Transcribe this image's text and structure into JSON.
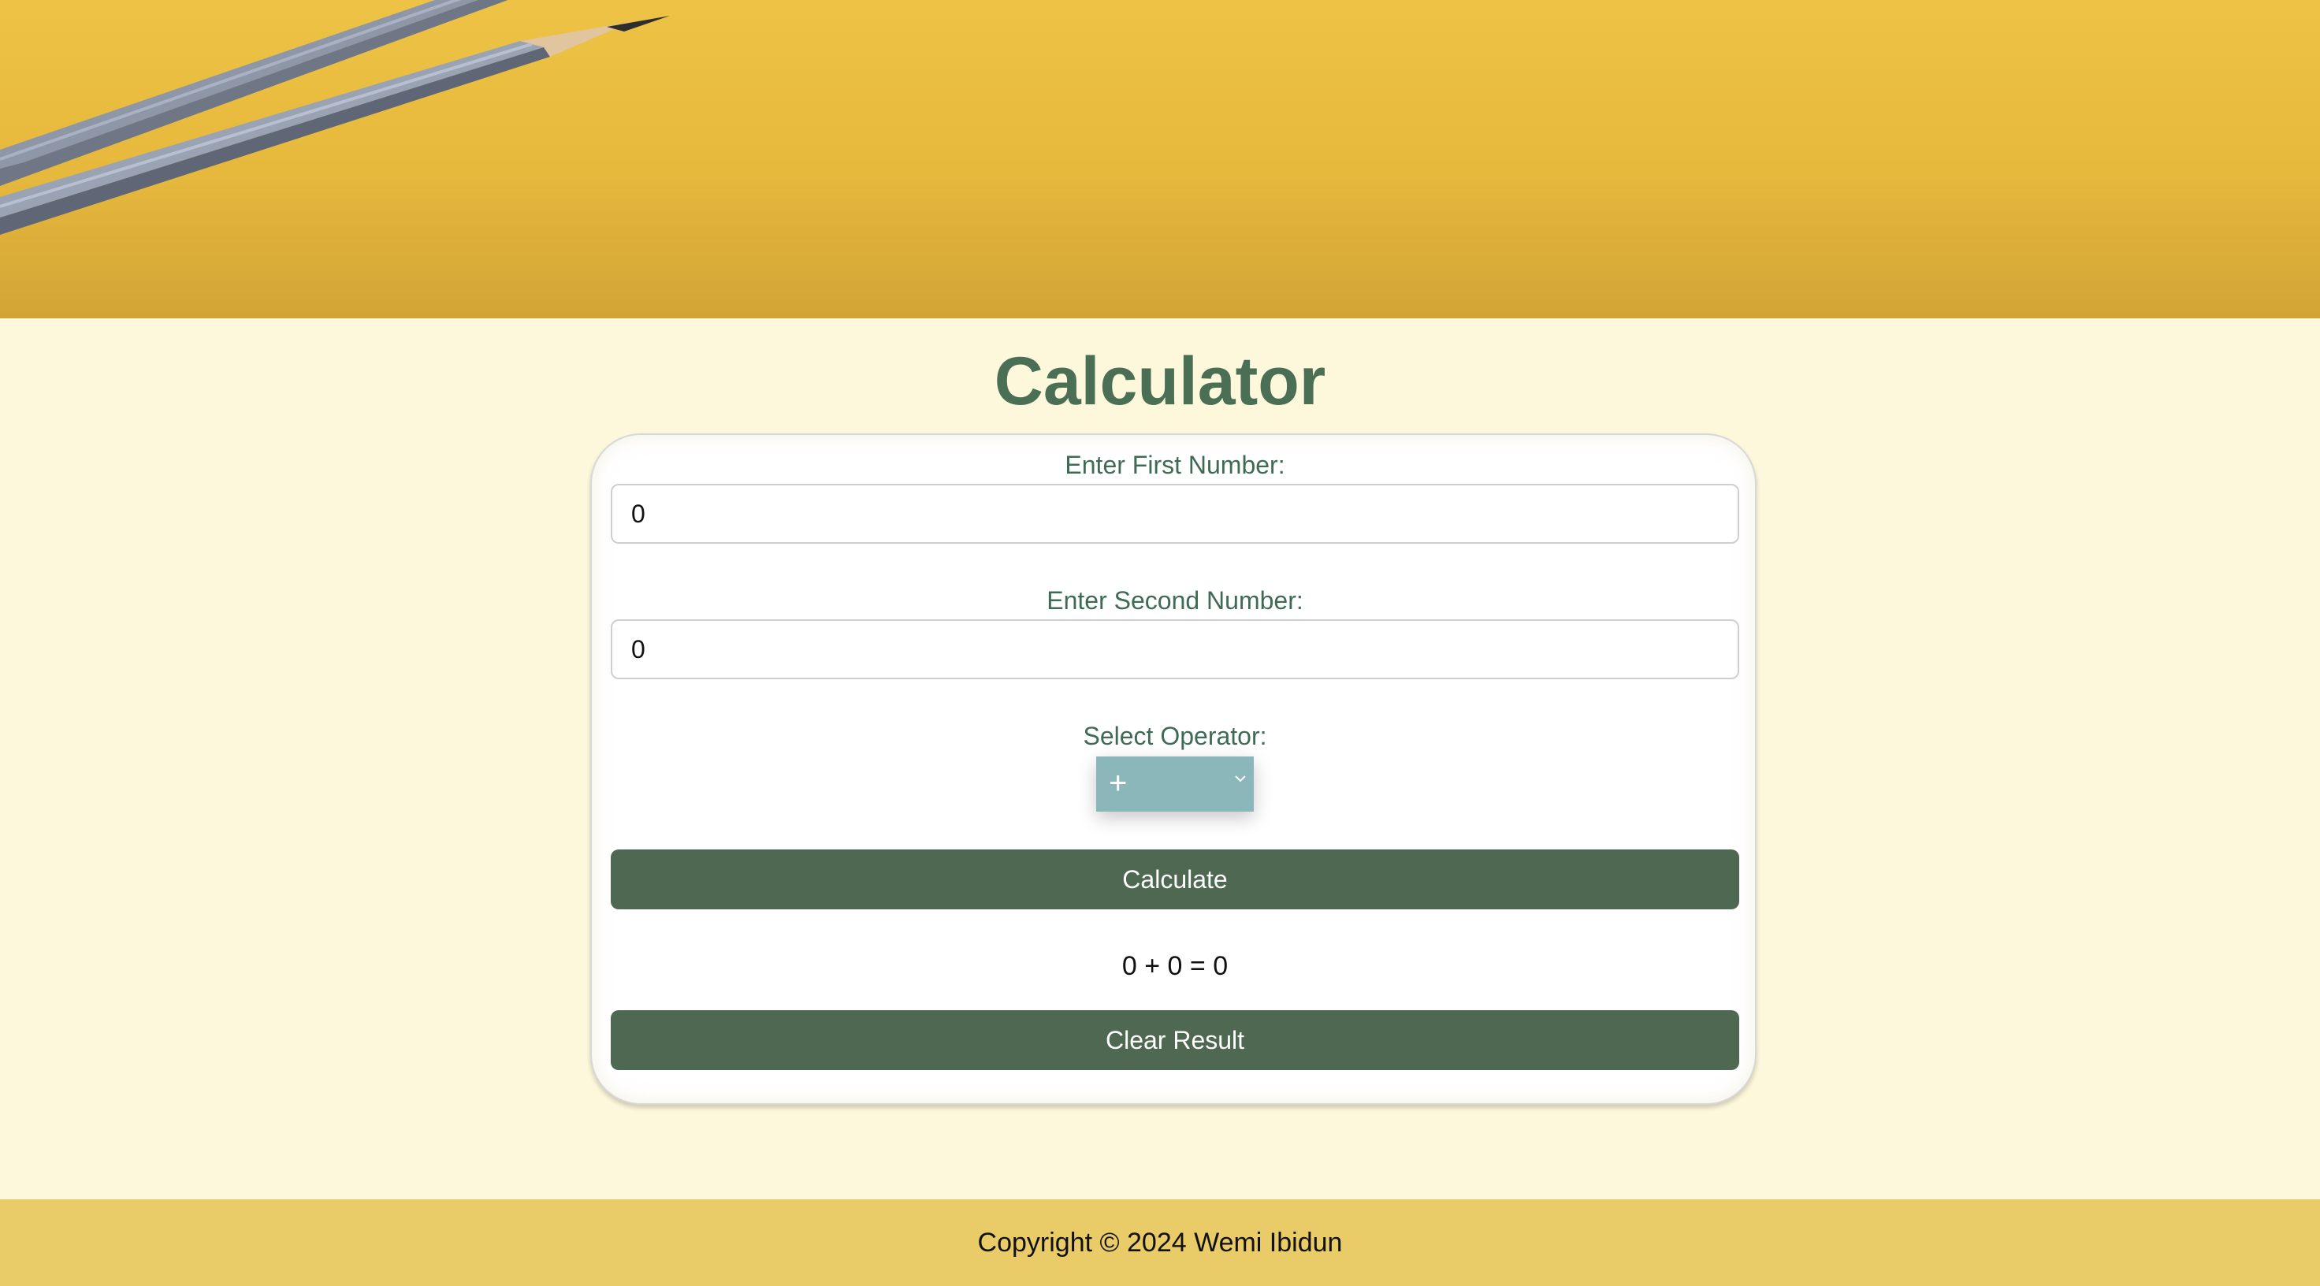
{
  "header": {
    "image": "pencils-on-yellow-banner"
  },
  "page": {
    "title": "Calculator"
  },
  "form": {
    "first_label": "Enter First Number:",
    "first_value": "0",
    "second_label": "Enter Second Number:",
    "second_value": "0",
    "operator_label": "Select Operator:",
    "operator_value": "+",
    "calculate_label": "Calculate",
    "result_text": "0 + 0 = 0",
    "clear_label": "Clear Result"
  },
  "footer": {
    "copyright": "Copyright © 2024 Wemi Ibidun"
  },
  "colors": {
    "banner": "#eec345",
    "background": "#fdf8dc",
    "title": "#4a6f55",
    "label": "#3f6b54",
    "button": "#4e6852",
    "select": "#8bb7ba",
    "footer": "#e9cc68"
  }
}
